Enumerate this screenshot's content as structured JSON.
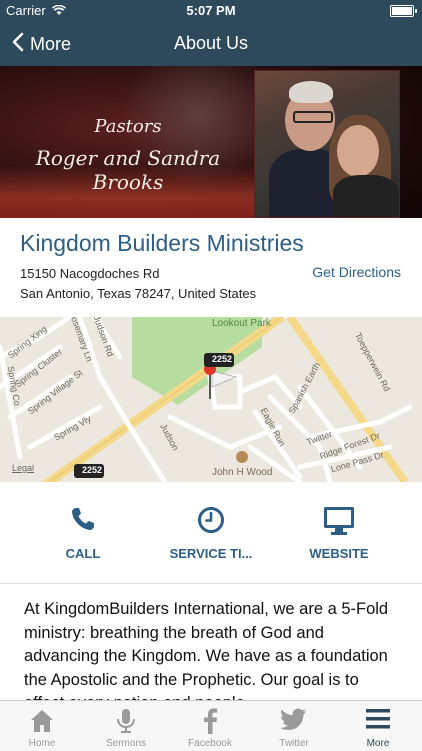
{
  "status_bar": {
    "carrier": "Carrier",
    "time": "5:07 PM"
  },
  "nav": {
    "back_label": "More",
    "title": "About Us"
  },
  "banner": {
    "line1": "Pastors",
    "line2": "Roger and Sandra Brooks"
  },
  "church": {
    "name": "Kingdom Builders Ministries",
    "address_line1": "15150 Nacogdoches Rd",
    "address_line2": "San Antonio, Texas 78247, United States",
    "directions_label": "Get Directions"
  },
  "map": {
    "park": "Lookout Park",
    "route_shield": "2252",
    "route_shield_2": "2252",
    "legal": "Legal",
    "poi": "John H Wood",
    "streets": [
      "Spring Xing",
      "Spring Cluster",
      "Spring Village St",
      "Spring Vly",
      "Judson Rd",
      "Judson",
      "Eagle Run",
      "Spanish Earth",
      "Toepperwein Rd",
      "Twitter",
      "Ridge Forest Dr",
      "Lone Pass Dr",
      "Spring Co",
      "Rosemary Ln"
    ]
  },
  "actions": [
    {
      "label": "CALL",
      "icon": "phone-icon"
    },
    {
      "label": "SERVICE TI...",
      "icon": "clock-icon"
    },
    {
      "label": "WEBSITE",
      "icon": "monitor-icon"
    }
  ],
  "description": "At KingdomBuilders International, we are a 5-Fold ministry: breathing the breath of God and advancing the Kingdom. We have as a foundation the Apostolic and the Prophetic. Our goal is to effect every nation and people",
  "tabs": [
    {
      "label": "Home",
      "icon": "home-icon"
    },
    {
      "label": "Sermons",
      "icon": "microphone-icon"
    },
    {
      "label": "Facebook",
      "icon": "facebook-icon"
    },
    {
      "label": "Twitter",
      "icon": "twitter-icon"
    },
    {
      "label": "More",
      "icon": "menu-icon"
    }
  ],
  "colors": {
    "nav_bg": "#2d4a5c",
    "accent": "#2d5f86",
    "tab_inactive": "#9a9a9a",
    "pin": "#e0342b"
  }
}
